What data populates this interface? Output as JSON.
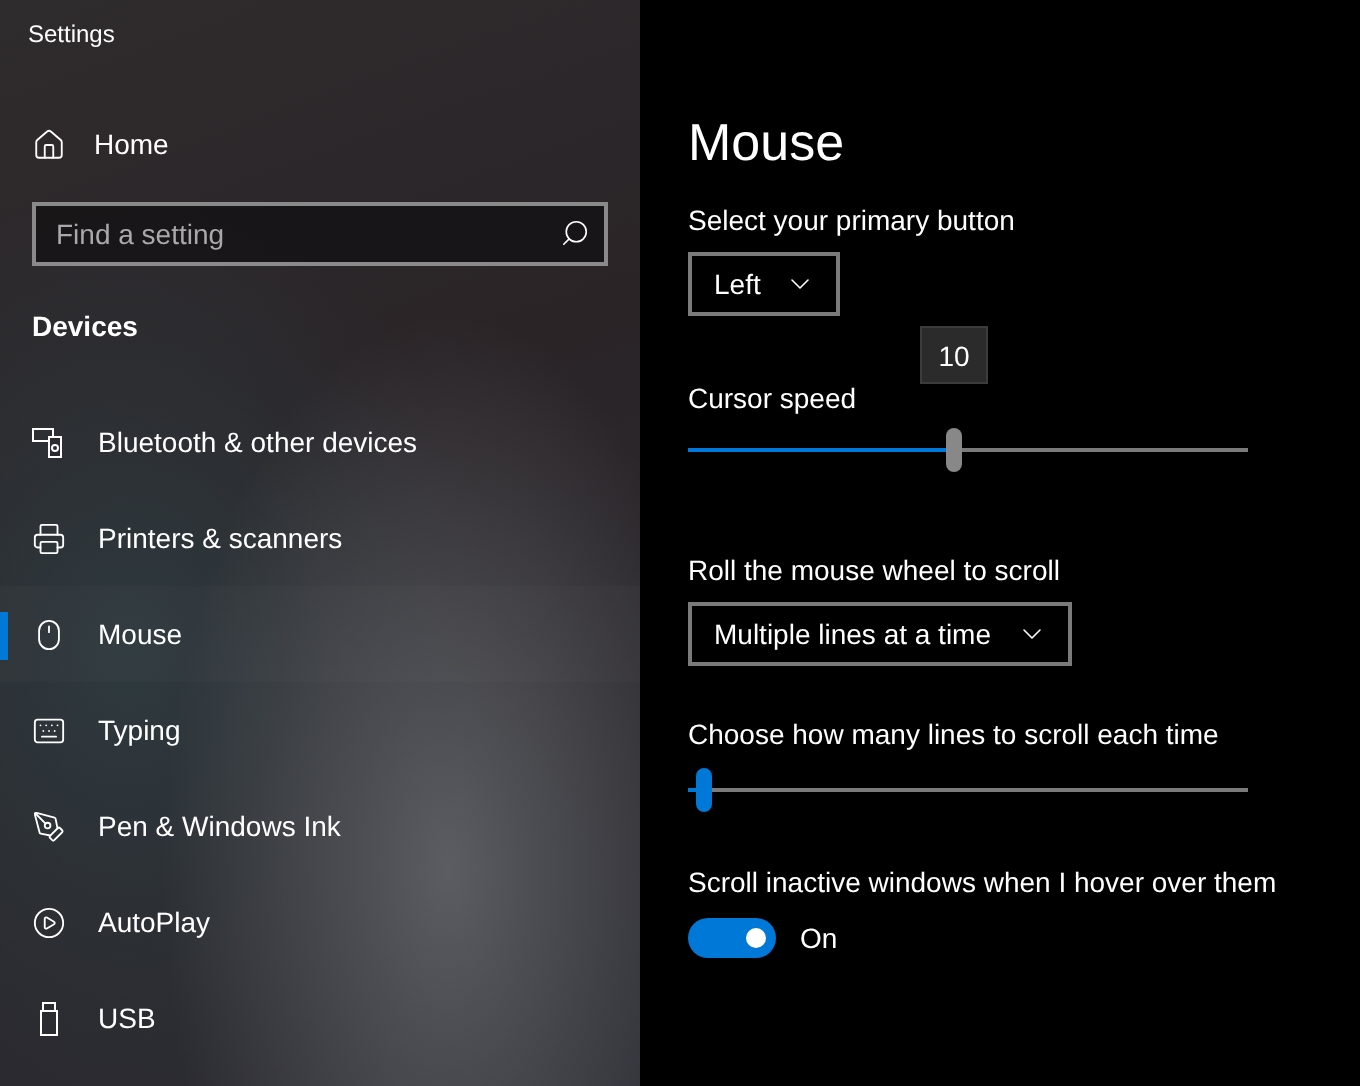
{
  "window": {
    "title": "Settings"
  },
  "sidebar": {
    "home": "Home",
    "search": {
      "placeholder": "Find a setting"
    },
    "section": "Devices",
    "items": [
      {
        "label": "Bluetooth & other devices",
        "selected": false
      },
      {
        "label": "Printers & scanners",
        "selected": false
      },
      {
        "label": "Mouse",
        "selected": true
      },
      {
        "label": "Typing",
        "selected": false
      },
      {
        "label": "Pen & Windows Ink",
        "selected": false
      },
      {
        "label": "AutoPlay",
        "selected": false
      },
      {
        "label": "USB",
        "selected": false
      }
    ]
  },
  "page": {
    "heading": "Mouse",
    "primary_button": {
      "label": "Select your primary button",
      "value": "Left"
    },
    "cursor_speed": {
      "label": "Cursor speed",
      "tooltip": "10",
      "level": 0.475
    },
    "wheel_scroll": {
      "label": "Roll the mouse wheel to scroll",
      "value": "Multiple lines at a time"
    },
    "lines_to_scroll": {
      "label": "Choose how many lines to scroll each time",
      "level": 0.03
    },
    "inactive_scroll": {
      "label": "Scroll inactive windows when I hover over them",
      "on": true,
      "state_label": "On"
    }
  }
}
